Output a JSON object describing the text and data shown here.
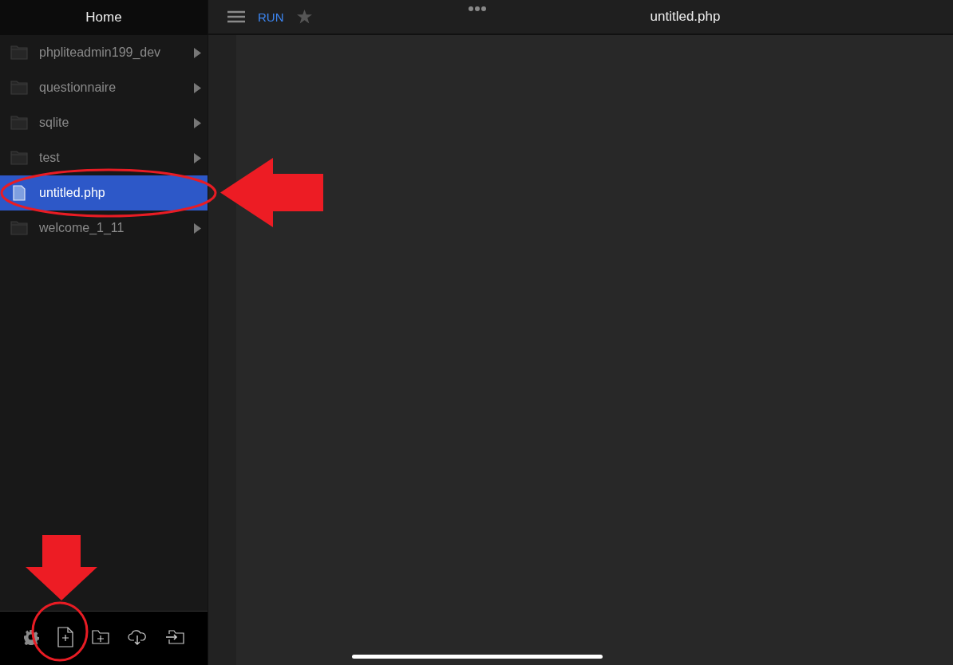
{
  "sidebar": {
    "title": "Home",
    "items": [
      {
        "kind": "folder",
        "name": "phpliteadmin199_dev",
        "selected": false
      },
      {
        "kind": "folder",
        "name": "questionnaire",
        "selected": false
      },
      {
        "kind": "folder",
        "name": "sqlite",
        "selected": false
      },
      {
        "kind": "folder",
        "name": "test",
        "selected": false
      },
      {
        "kind": "file",
        "name": "untitled.php",
        "selected": true
      },
      {
        "kind": "folder",
        "name": "welcome_1_11",
        "selected": false
      }
    ],
    "toolbar": [
      {
        "kind": "settings"
      },
      {
        "kind": "new-file"
      },
      {
        "kind": "new-folder"
      },
      {
        "kind": "cloud-download"
      },
      {
        "kind": "import"
      }
    ]
  },
  "editor": {
    "run_label": "RUN",
    "title": "untitled.php"
  },
  "annotations": [
    {
      "kind": "ellipse"
    },
    {
      "kind": "arrow-left"
    },
    {
      "kind": "arrow-down"
    },
    {
      "kind": "circle"
    }
  ]
}
